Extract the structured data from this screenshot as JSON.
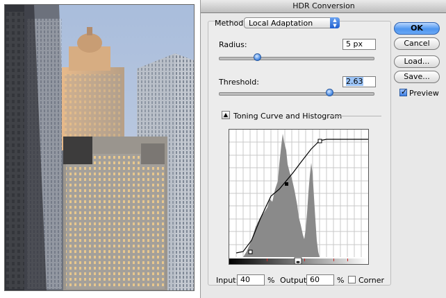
{
  "dialog": {
    "title": "HDR Conversion",
    "method_label": "Method:",
    "method_value": "Local Adaptation",
    "radius_label": "Radius:",
    "radius_value": "5 px",
    "radius_level": 0.25,
    "threshold_label": "Threshold:",
    "threshold_value": "2.63",
    "threshold_level": 0.72,
    "toning_label": "Toning Curve and Histogram",
    "input_label": "Input:",
    "input_value": "40",
    "input_unit": "%",
    "output_label": "Output:",
    "output_value": "60",
    "output_unit": "%",
    "corner_label": "Corner",
    "corner_checked": false
  },
  "buttons": {
    "ok": "OK",
    "cancel": "Cancel",
    "load": "Load...",
    "save": "Save..."
  },
  "preview": {
    "label": "Preview",
    "checked": true
  },
  "colors": {
    "accent": "#3e7fe3",
    "histogram": "#8a8a8a",
    "sky": "#9fb4d6",
    "lit_window": "#f2c98a"
  },
  "icons": [
    "popup-arrows-icon",
    "disclosure-triangle-icon",
    "checkmark-icon"
  ]
}
